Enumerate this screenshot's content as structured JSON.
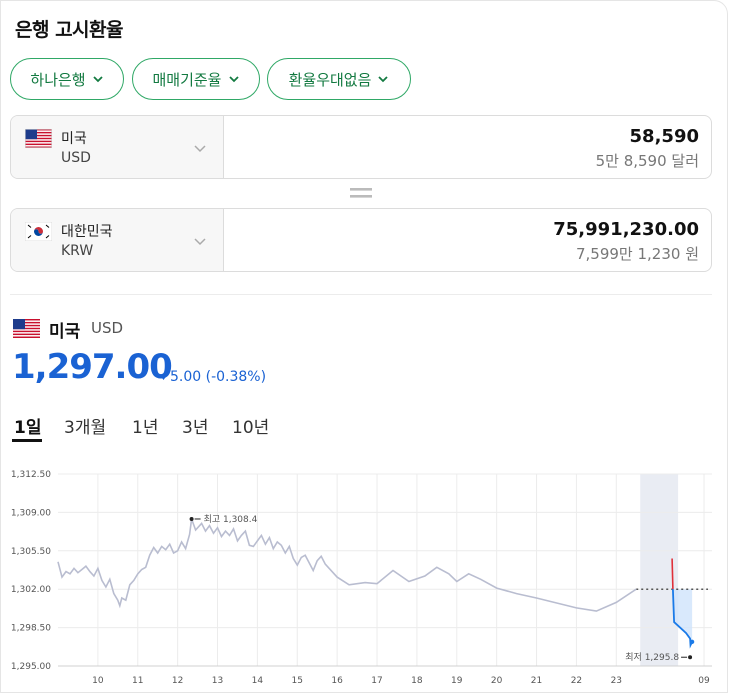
{
  "title": "은행 고시환율",
  "chips": [
    {
      "label": "하나은행"
    },
    {
      "label": "매매기준율"
    },
    {
      "label": "환율우대없음"
    }
  ],
  "from": {
    "country": "미국",
    "code": "USD",
    "amount": "58,590",
    "words": "5만 8,590 달러"
  },
  "to": {
    "country": "대한민국",
    "code": "KRW",
    "amount": "75,991,230.00",
    "words": "7,599만 1,230 원"
  },
  "summary": {
    "country": "미국",
    "code": "USD",
    "rate": "1,297.00",
    "change": "5.00 (-0.38%)"
  },
  "tabs": [
    "1일",
    "3개월",
    "1년",
    "3년",
    "10년"
  ],
  "colors": {
    "accent": "#1a62d3",
    "chip_border": "#2fa866",
    "chip_text": "#137a41",
    "up": "#e0303a",
    "down": "#1a7ae8"
  },
  "chart_data": {
    "type": "line",
    "y_ticks": [
      "1,312.50",
      "1,309.00",
      "1,305.50",
      "1,302.00",
      "1,298.50",
      "1,295.00"
    ],
    "x_ticks": [
      "10",
      "11",
      "12",
      "13",
      "14",
      "15",
      "16",
      "17",
      "18",
      "19",
      "20",
      "21",
      "22",
      "23",
      "09"
    ],
    "ylim": [
      1295.0,
      1312.5
    ],
    "max_label": "최고 1,308.4",
    "min_label": "최저 1,295.8",
    "prev_close": 1302.0,
    "series": [
      {
        "values": [
          [
            9.0,
            1304.5
          ],
          [
            9.1,
            1303.1
          ],
          [
            9.2,
            1303.6
          ],
          [
            9.3,
            1303.4
          ],
          [
            9.4,
            1303.9
          ],
          [
            9.5,
            1303.5
          ],
          [
            9.6,
            1303.8
          ],
          [
            9.7,
            1304.1
          ],
          [
            9.8,
            1303.6
          ],
          [
            9.9,
            1303.2
          ],
          [
            10.0,
            1303.9
          ],
          [
            10.1,
            1302.8
          ],
          [
            10.2,
            1302.2
          ],
          [
            10.3,
            1302.9
          ],
          [
            10.4,
            1301.6
          ],
          [
            10.5,
            1301.0
          ],
          [
            10.55,
            1300.5
          ],
          [
            10.6,
            1301.2
          ],
          [
            10.7,
            1301.0
          ],
          [
            10.8,
            1302.4
          ],
          [
            10.9,
            1302.8
          ],
          [
            11.0,
            1303.4
          ],
          [
            11.1,
            1303.8
          ],
          [
            11.2,
            1304.0
          ],
          [
            11.3,
            1305.1
          ],
          [
            11.4,
            1305.8
          ],
          [
            11.5,
            1305.3
          ],
          [
            11.6,
            1305.9
          ],
          [
            11.7,
            1305.6
          ],
          [
            11.8,
            1306.1
          ],
          [
            11.9,
            1305.3
          ],
          [
            12.0,
            1305.5
          ],
          [
            12.1,
            1306.3
          ],
          [
            12.2,
            1305.7
          ],
          [
            12.3,
            1307.0
          ],
          [
            12.35,
            1308.4
          ],
          [
            12.45,
            1307.4
          ],
          [
            12.6,
            1308.0
          ],
          [
            12.7,
            1307.3
          ],
          [
            12.8,
            1307.8
          ],
          [
            12.9,
            1307.1
          ],
          [
            13.0,
            1307.6
          ],
          [
            13.1,
            1306.8
          ],
          [
            13.2,
            1307.3
          ],
          [
            13.3,
            1306.9
          ],
          [
            13.4,
            1307.5
          ],
          [
            13.5,
            1306.4
          ],
          [
            13.6,
            1306.9
          ],
          [
            13.7,
            1307.3
          ],
          [
            13.8,
            1306.0
          ],
          [
            13.9,
            1305.9
          ],
          [
            14.0,
            1306.4
          ],
          [
            14.1,
            1306.9
          ],
          [
            14.2,
            1306.1
          ],
          [
            14.3,
            1306.7
          ],
          [
            14.4,
            1305.7
          ],
          [
            14.5,
            1306.3
          ],
          [
            14.6,
            1306.0
          ],
          [
            14.7,
            1305.3
          ],
          [
            14.8,
            1305.9
          ],
          [
            14.9,
            1304.8
          ],
          [
            15.0,
            1304.2
          ],
          [
            15.1,
            1304.9
          ],
          [
            15.2,
            1305.1
          ],
          [
            15.3,
            1304.4
          ],
          [
            15.4,
            1303.7
          ],
          [
            15.5,
            1304.6
          ],
          [
            15.6,
            1305.0
          ],
          [
            15.7,
            1304.3
          ],
          [
            16.0,
            1303.1
          ],
          [
            16.3,
            1302.4
          ],
          [
            16.7,
            1302.6
          ],
          [
            17.0,
            1302.5
          ],
          [
            17.4,
            1303.7
          ],
          [
            17.8,
            1302.7
          ],
          [
            18.2,
            1303.2
          ],
          [
            18.5,
            1304.0
          ],
          [
            18.8,
            1303.4
          ],
          [
            19.0,
            1302.7
          ],
          [
            19.3,
            1303.4
          ],
          [
            19.6,
            1302.9
          ],
          [
            20.0,
            1302.1
          ],
          [
            20.5,
            1301.6
          ],
          [
            21.0,
            1301.2
          ],
          [
            22.0,
            1300.3
          ],
          [
            22.5,
            1300.0
          ],
          [
            23.0,
            1300.8
          ],
          [
            23.5,
            1302.0
          ]
        ]
      },
      {
        "name_hidden": "",
        "values": [
          [
            24.4,
            1304.8
          ],
          [
            24.42,
            1302.0
          ]
        ]
      },
      {
        "values": [
          [
            24.42,
            1302.0
          ],
          [
            24.45,
            1299.0
          ],
          [
            24.75,
            1298.0
          ],
          [
            24.85,
            1297.5
          ],
          [
            24.86,
            1296.9
          ],
          [
            24.9,
            1297.2
          ]
        ]
      }
    ]
  }
}
